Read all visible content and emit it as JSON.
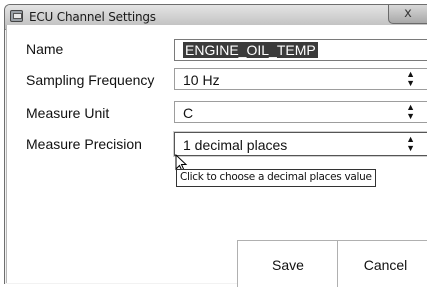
{
  "window": {
    "title": "ECU Channel Settings",
    "close_label": "x"
  },
  "form": {
    "name_label": "Name",
    "name_value": "ENGINE_OIL_TEMP",
    "sampling_label": "Sampling Frequency",
    "sampling_value": "10 Hz",
    "unit_label": "Measure Unit",
    "unit_value": "C",
    "precision_label": "Measure Precision",
    "precision_value": "1 decimal places",
    "precision_tooltip": "Click to choose a decimal places value"
  },
  "buttons": {
    "save": "Save",
    "cancel": "Cancel"
  },
  "icons": {
    "app": "ecu-window-icon",
    "select_arrows": "up-down-arrows-icon",
    "cursor": "mouse-pointer-icon"
  }
}
